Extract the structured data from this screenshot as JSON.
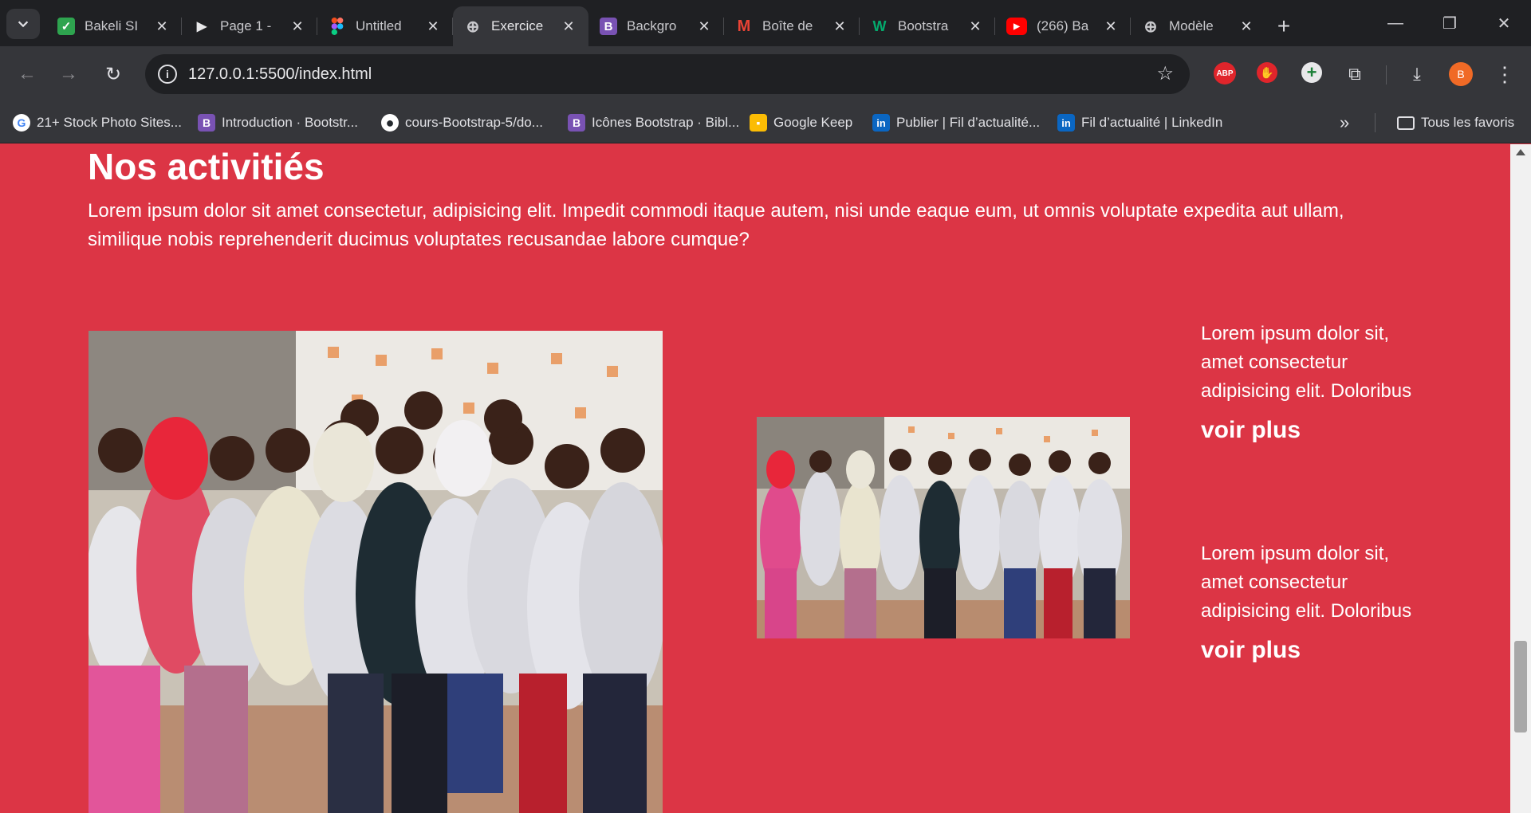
{
  "browser": {
    "tabs": [
      {
        "title": "Bakeli SI",
        "icon": "bakeli-icon",
        "color": "#2ea44f"
      },
      {
        "title": "Page 1 -",
        "icon": "play-icon",
        "color": "#000000"
      },
      {
        "title": "Untitled",
        "icon": "figma-icon",
        "color": "#f24e1e"
      },
      {
        "title": "Exercice",
        "icon": "globe-icon",
        "color": "#9aa0a6",
        "active": true
      },
      {
        "title": "Backgro",
        "icon": "bootstrap-icon",
        "color": "#7952b3"
      },
      {
        "title": "Boîte de",
        "icon": "gmail-icon",
        "color": "#ea4335"
      },
      {
        "title": "Bootstra",
        "icon": "w3-icon",
        "color": "#04aa6d"
      },
      {
        "title": "(266) Ba",
        "icon": "youtube-icon",
        "color": "#ff0000"
      },
      {
        "title": "Modèle",
        "icon": "globe-icon",
        "color": "#9aa0a6"
      }
    ],
    "url": "127.0.0.1:5500/index.html",
    "profile_initial": "B",
    "abp_label": "ABP",
    "bookmarks": [
      {
        "label": "21+ Stock Photo Sites...",
        "icon": "google-icon",
        "color": "#ffffff",
        "glyph": "G"
      },
      {
        "label": "Introduction · Bootstr...",
        "icon": "bootstrap-icon",
        "color": "#7952b3",
        "glyph": "B"
      },
      {
        "label": "cours-Bootstrap-5/do...",
        "icon": "github-icon",
        "color": "#ffffff",
        "glyph": "●"
      },
      {
        "label": "Icônes Bootstrap · Bibl...",
        "icon": "bootstrap-icon",
        "color": "#7952b3",
        "glyph": "B"
      },
      {
        "label": "Google Keep",
        "icon": "keep-icon",
        "color": "#fbbc04",
        "glyph": "▪"
      },
      {
        "label": "Publier | Fil d’actualité...",
        "icon": "linkedin-icon",
        "color": "#0a66c2",
        "glyph": "in"
      },
      {
        "label": "Fil d’actualité | LinkedIn",
        "icon": "linkedin-icon",
        "color": "#0a66c2",
        "glyph": "in"
      }
    ],
    "all_bookmarks_label": "Tous les favoris"
  },
  "page": {
    "heading": "Nos activitiés",
    "lead": "Lorem ipsum dolor sit amet consectetur, adipisicing elit. Impedit commodi itaque autem, nisi unde eaque eum, ut omnis voluptate expedita aut ullam, similique nobis reprehenderit ducimus voluptates recusandae labore cumque?",
    "items": [
      {
        "text": "Lorem ipsum dolor sit, amet consectetur adipisicing elit. Doloribus",
        "link": "voir plus"
      },
      {
        "text": "Lorem ipsum dolor sit, amet consectetur adipisicing elit. Doloribus",
        "link": "voir plus"
      }
    ],
    "background_color": "#dc3545"
  }
}
